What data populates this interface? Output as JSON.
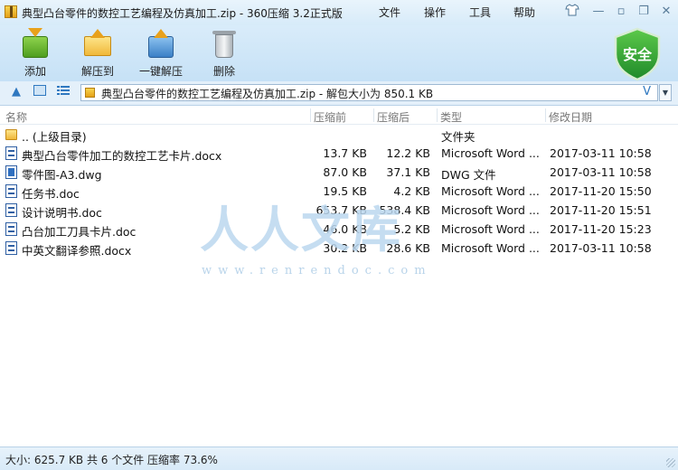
{
  "window": {
    "title": "典型凸台零件的数控工艺编程及仿真加工.zip - 360压缩 3.2正式版",
    "menus": [
      "文件",
      "操作",
      "工具",
      "帮助"
    ]
  },
  "toolbar": {
    "buttons": [
      {
        "label": "添加",
        "icon": "add-archive-icon"
      },
      {
        "label": "解压到",
        "icon": "extract-to-icon"
      },
      {
        "label": "一键解压",
        "icon": "one-click-extract-icon"
      },
      {
        "label": "删除",
        "icon": "delete-trash-icon"
      }
    ],
    "security_badge": "安全"
  },
  "address": {
    "path": "典型凸台零件的数控工艺编程及仿真加工.zip - 解包大小为 850.1 KB",
    "v_label": "V"
  },
  "columns": [
    "名称",
    "压缩前",
    "压缩后",
    "类型",
    "修改日期"
  ],
  "files": [
    {
      "name": ".. (上级目录)",
      "before": "",
      "after": "",
      "type": "文件夹",
      "date": "",
      "icon": "folder-icon"
    },
    {
      "name": "典型凸台零件加工的数控工艺卡片.docx",
      "before": "13.7 KB",
      "after": "12.2 KB",
      "type": "Microsoft Word ...",
      "date": "2017-03-11 10:58",
      "icon": "word-doc-icon"
    },
    {
      "name": "零件图-A3.dwg",
      "before": "87.0 KB",
      "after": "37.1 KB",
      "type": "DWG 文件",
      "date": "2017-03-11 10:58",
      "icon": "dwg-file-icon"
    },
    {
      "name": "任务书.doc",
      "before": "19.5 KB",
      "after": "4.2 KB",
      "type": "Microsoft Word ...",
      "date": "2017-11-20 15:50",
      "icon": "word-doc-icon"
    },
    {
      "name": "设计说明书.doc",
      "before": "653.7 KB",
      "after": "538.4 KB",
      "type": "Microsoft Word ...",
      "date": "2017-11-20 15:51",
      "icon": "word-doc-icon"
    },
    {
      "name": "凸台加工刀具卡片.doc",
      "before": "46.0 KB",
      "after": "5.2 KB",
      "type": "Microsoft Word ...",
      "date": "2017-11-20 15:23",
      "icon": "word-doc-icon"
    },
    {
      "name": "中英文翻译参照.docx",
      "before": "30.2 KB",
      "after": "28.6 KB",
      "type": "Microsoft Word ...",
      "date": "2017-03-11 10:58",
      "icon": "word-doc-icon"
    }
  ],
  "watermark": {
    "big": "人人文库",
    "url": "www.renrendoc.com"
  },
  "status": "大小: 625.7 KB 共 6 个文件 压缩率 73.6%"
}
